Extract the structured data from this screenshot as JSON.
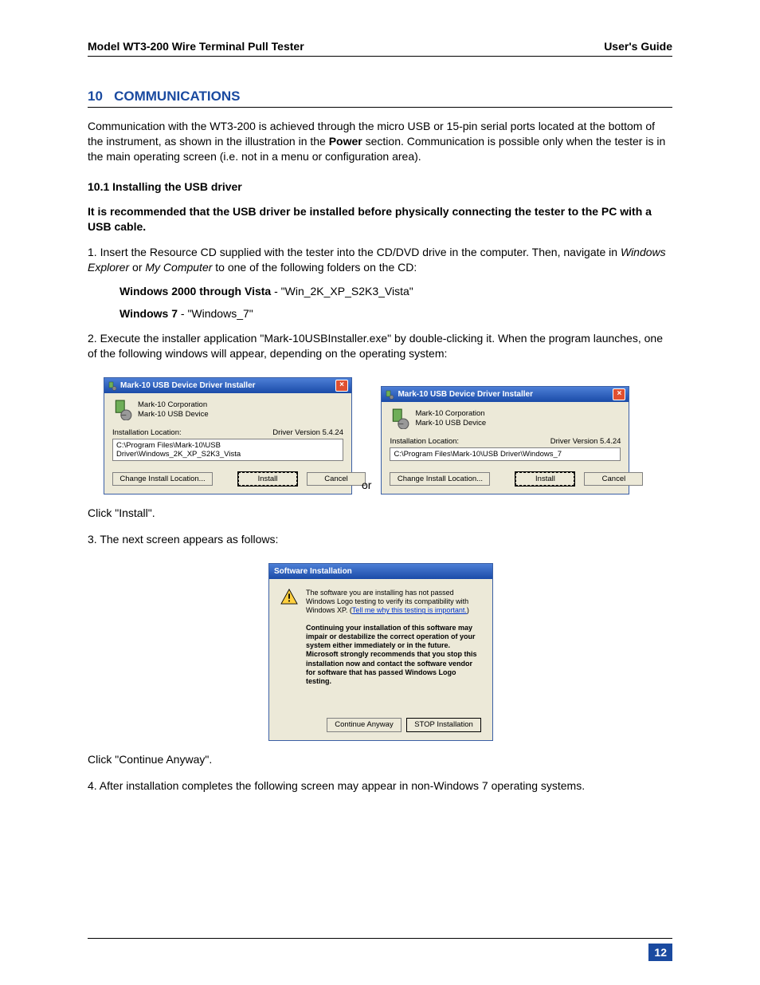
{
  "header": {
    "left": "Model WT3-200 Wire Terminal Pull Tester",
    "right": "User's Guide"
  },
  "section": {
    "number": "10",
    "title": "COMMUNICATIONS"
  },
  "para1_a": "Communication with the WT3-200 is achieved through the micro USB or 15-pin serial ports located at the bottom of the instrument, as shown in the illustration in the ",
  "para1_power": "Power",
  "para1_b": " section. Communication is possible only when the tester is in the main operating screen (i.e. not in a menu or configuration area).",
  "subhead1": "10.1 Installing the USB driver",
  "rec": "It is recommended that the USB driver be installed before physically connecting the tester to the PC with a USB cable.",
  "step1_a": "1. Insert the Resource CD supplied with the tester into the CD/DVD drive in the computer. Then, navigate in ",
  "step1_we": "Windows Explorer",
  "step1_or": " or ",
  "step1_mc": "My Computer",
  "step1_b": " to one of the following folders on the CD:",
  "win_vista_label": "Windows 2000 through Vista",
  "win_vista_val": " - \"Win_2K_XP_S2K3_Vista\"",
  "win7_label": "Windows 7",
  "win7_val": " - \"Windows_7\"",
  "step2": "2. Execute the installer application \"Mark-10USBInstaller.exe\" by double-clicking it. When the program launches, one of the following windows will appear, depending on the operating system:",
  "or_text": "or",
  "click_install": "Click \"Install\".",
  "step3": "3. The next screen appears as follows:",
  "click_continue": "Click \"Continue Anyway\".",
  "step4": "4. After installation completes the following screen may appear in non-Windows 7 operating systems.",
  "dlgA": {
    "title": "Mark-10 USB Device Driver Installer",
    "corp": "Mark-10 Corporation",
    "device": "Mark-10 USB Device",
    "loc_label": "Installation Location:",
    "driver_ver": "Driver Version 5.4.24",
    "path": "C:\\Program Files\\Mark-10\\USB Driver\\Windows_2K_XP_S2K3_Vista",
    "change": "Change Install Location...",
    "install": "Install",
    "cancel": "Cancel"
  },
  "dlgB": {
    "title": "Mark-10 USB Device Driver Installer",
    "corp": "Mark-10 Corporation",
    "device": "Mark-10 USB Device",
    "loc_label": "Installation Location:",
    "driver_ver": "Driver Version 5.4.24",
    "path": "C:\\Program Files\\Mark-10\\USB Driver\\Windows_7",
    "change": "Change Install Location...",
    "install": "Install",
    "cancel": "Cancel"
  },
  "dlgC": {
    "title": "Software Installation",
    "msg1": "The software you are installing has not passed Windows Logo testing to verify its compatibility with Windows XP. (",
    "link": "Tell me why this testing is important.",
    "msg1_end": ")",
    "msg2": "Continuing your installation of this software may impair or destabilize the correct operation of your system either immediately or in the future. Microsoft strongly recommends that you stop this installation now and contact the software vendor for software that has passed Windows Logo testing.",
    "continue": "Continue Anyway",
    "stop": "STOP Installation"
  },
  "page_number": "12"
}
